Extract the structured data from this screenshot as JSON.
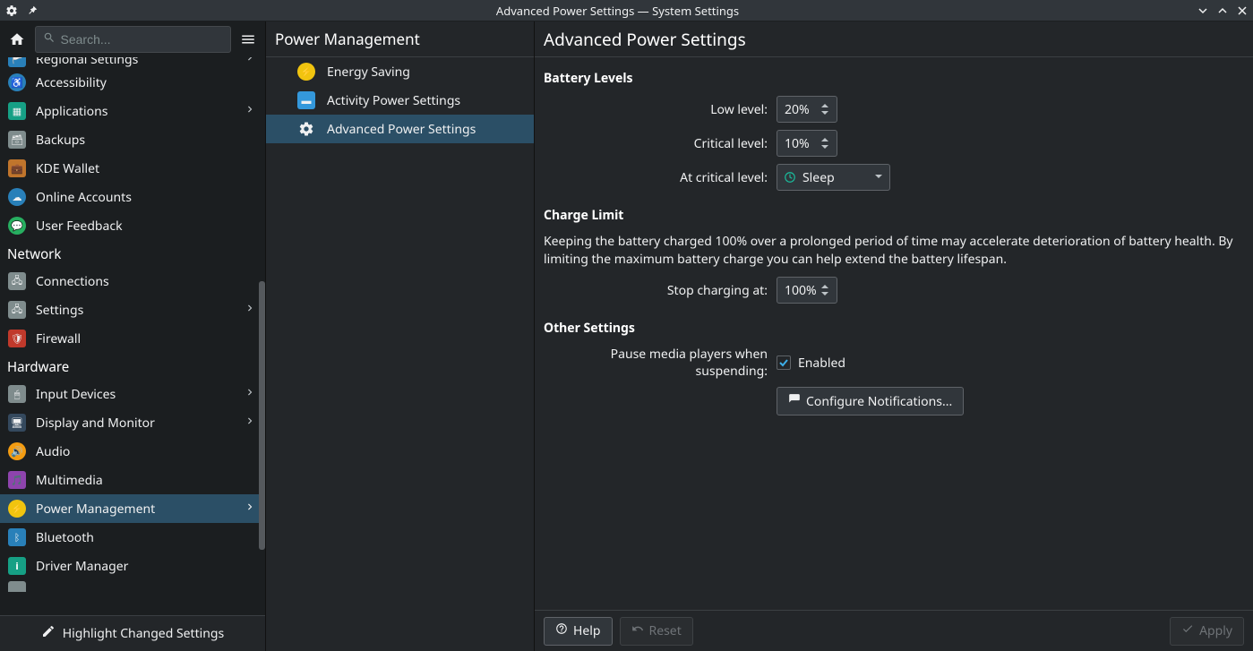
{
  "window": {
    "title": "Advanced Power Settings — System Settings"
  },
  "search": {
    "placeholder": "Search..."
  },
  "sidebar": {
    "cut_top": {
      "label": "Regional Settings",
      "arrow": true
    },
    "items_personalization": [
      {
        "label": "Accessibility",
        "icon": "accessibility",
        "arrow": false
      },
      {
        "label": "Applications",
        "icon": "apps",
        "arrow": true
      },
      {
        "label": "Backups",
        "icon": "backups",
        "arrow": false
      },
      {
        "label": "KDE Wallet",
        "icon": "wallet",
        "arrow": false
      },
      {
        "label": "Online Accounts",
        "icon": "online",
        "arrow": false
      },
      {
        "label": "User Feedback",
        "icon": "feedback",
        "arrow": false
      }
    ],
    "cat_network": "Network",
    "items_network": [
      {
        "label": "Connections",
        "icon": "connections",
        "arrow": false
      },
      {
        "label": "Settings",
        "icon": "netsettings",
        "arrow": true
      },
      {
        "label": "Firewall",
        "icon": "firewall",
        "arrow": false
      }
    ],
    "cat_hardware": "Hardware",
    "items_hardware": [
      {
        "label": "Input Devices",
        "icon": "input",
        "arrow": true
      },
      {
        "label": "Display and Monitor",
        "icon": "display",
        "arrow": true
      },
      {
        "label": "Audio",
        "icon": "audio",
        "arrow": false
      },
      {
        "label": "Multimedia",
        "icon": "multimedia",
        "arrow": false
      },
      {
        "label": "Power Management",
        "icon": "power",
        "arrow": true,
        "active": true
      },
      {
        "label": "Bluetooth",
        "icon": "bluetooth",
        "arrow": false
      },
      {
        "label": "Driver Manager",
        "icon": "driver",
        "arrow": false
      }
    ],
    "highlight_label": "Highlight Changed Settings"
  },
  "subcol": {
    "header": "Power Management",
    "items": [
      {
        "label": "Energy Saving",
        "icon": "energy"
      },
      {
        "label": "Activity Power Settings",
        "icon": "activity"
      },
      {
        "label": "Advanced Power Settings",
        "icon": "advanced",
        "active": true
      }
    ]
  },
  "content": {
    "header": "Advanced Power Settings",
    "sections": {
      "battery_levels_title": "Battery Levels",
      "low_level_label": "Low level:",
      "low_level_value": "20%",
      "critical_level_label": "Critical level:",
      "critical_level_value": "10%",
      "at_critical_label": "At critical level:",
      "at_critical_value": "Sleep",
      "charge_limit_title": "Charge Limit",
      "charge_limit_desc": "Keeping the battery charged 100% over a prolonged period of time may accelerate deterioration of battery health. By limiting the maximum battery charge you can help extend the battery lifespan.",
      "stop_charging_label": "Stop charging at:",
      "stop_charging_value": "100%",
      "other_settings_title": "Other Settings",
      "pause_media_label": "Pause media players when suspending:",
      "enabled_label": "Enabled",
      "configure_notifications": "Configure Notifications..."
    },
    "footer": {
      "help": "Help",
      "reset": "Reset",
      "apply": "Apply"
    }
  }
}
